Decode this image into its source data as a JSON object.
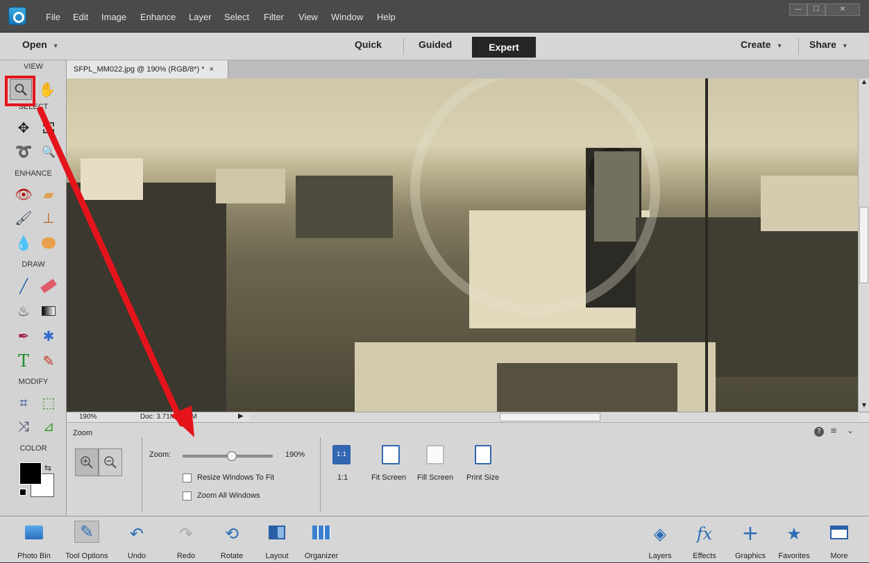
{
  "menubar": {
    "items": [
      "File",
      "Edit",
      "Image",
      "Enhance",
      "Layer",
      "Select",
      "Filter",
      "View",
      "Window",
      "Help"
    ],
    "window_controls": [
      "—",
      "☐",
      "✕"
    ]
  },
  "modebar": {
    "open_label": "Open",
    "tabs": [
      "Quick",
      "Guided",
      "Expert"
    ],
    "active_tab": "Expert",
    "create_label": "Create",
    "share_label": "Share"
  },
  "toolbox": {
    "sections": [
      "VIEW",
      "SELECT",
      "ENHANCE",
      "DRAW",
      "MODIFY",
      "COLOR"
    ]
  },
  "document": {
    "tab_title": "SFPL_MM022.jpg @ 190% (RGB/8*) *",
    "close_glyph": "×"
  },
  "statusbar": {
    "zoom": "190%",
    "doc_info": "Doc: 3.71M/3.71M"
  },
  "tool_options": {
    "tool_name": "Zoom",
    "zoom_label": "Zoom:",
    "zoom_value": "190%",
    "zoom_fraction": 0.55,
    "resize_windows": "Resize Windows To Fit",
    "zoom_all_windows": "Zoom All Windows",
    "presets": [
      "1:1",
      "Fit Screen",
      "Fill Screen",
      "Print Size"
    ],
    "preset_icon_label": "1:1"
  },
  "bottombar": {
    "left": [
      "Photo Bin",
      "Tool Options",
      "Undo",
      "Redo",
      "Rotate",
      "Layout",
      "Organizer"
    ],
    "right": [
      "Layers",
      "Effects",
      "Graphics",
      "Favorites",
      "More"
    ]
  },
  "colors": {
    "accent": "#3166b0",
    "highlight": "#e5141b",
    "chrome_dark": "#4a4a4a",
    "panel": "#d6d6d6"
  }
}
